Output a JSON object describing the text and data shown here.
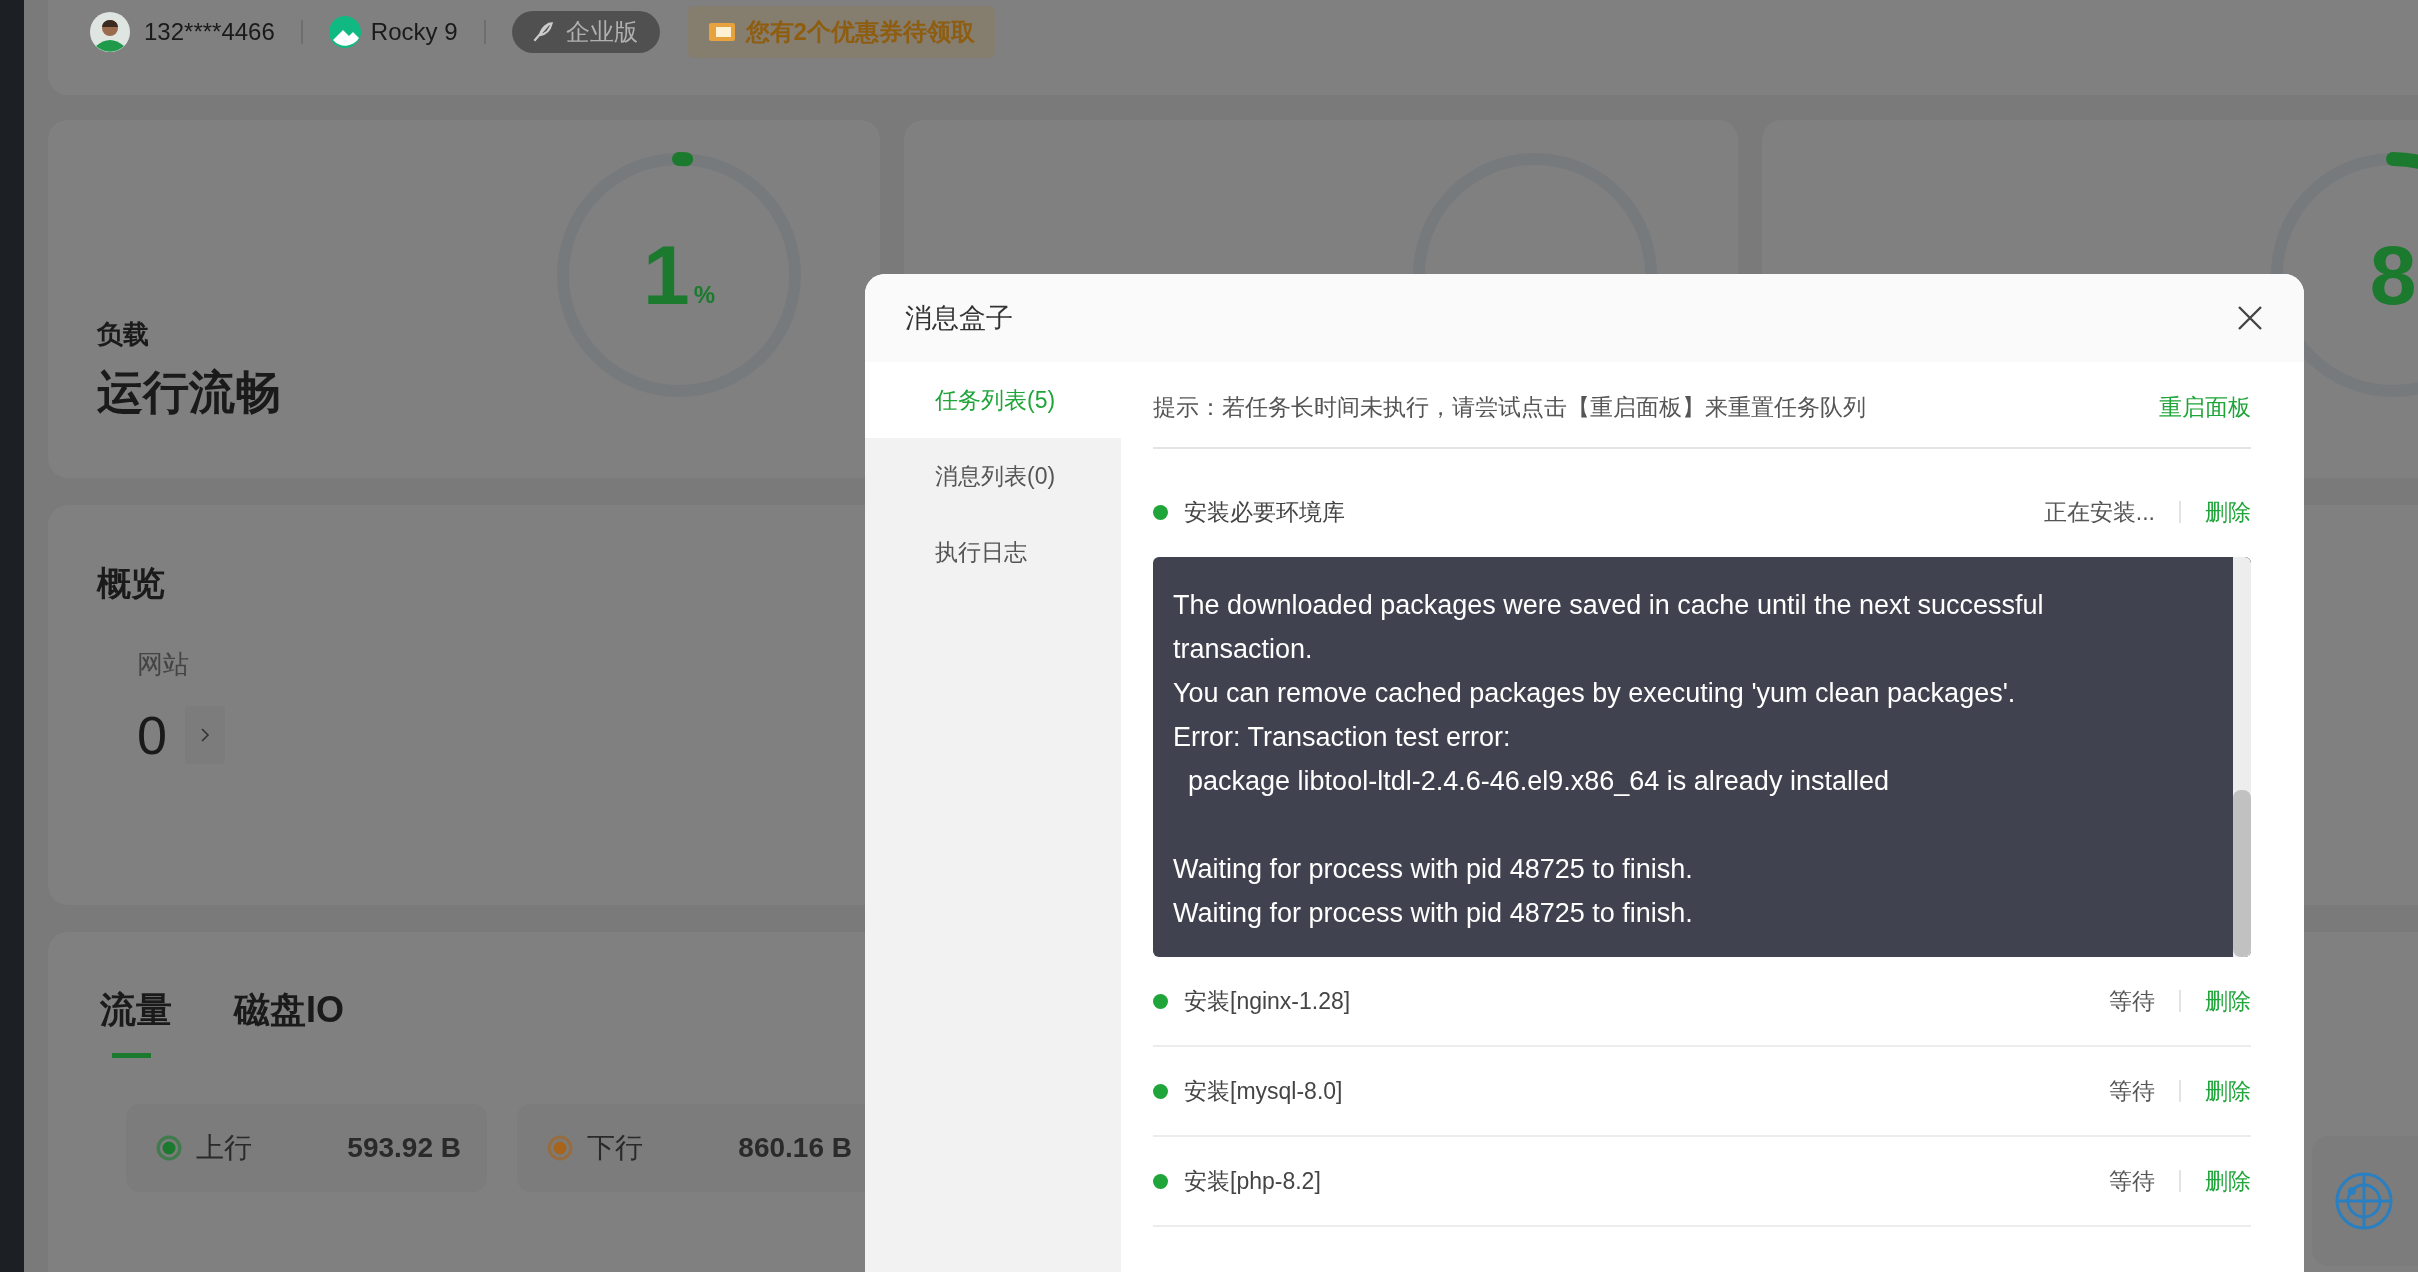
{
  "topbar": {
    "account": "132****4466",
    "os": "Rocky 9",
    "edition": "企业版",
    "coupon": "您有2个优惠券待领取"
  },
  "gauges": [
    {
      "kind": "gauge",
      "label": "负载",
      "status": "运行流畅",
      "value": "1",
      "unit": "%",
      "level": 0.01,
      "color": "#1b7a2e"
    },
    {
      "kind": "gauge"
    },
    {
      "kind": "gauge",
      "value": "8",
      "level": 0.08,
      "color": "#1b7a2e"
    }
  ],
  "overview": {
    "title": "概览",
    "stats": [
      {
        "label": "网站",
        "value": "0"
      }
    ]
  },
  "traffic": {
    "tabs": [
      {
        "label": "流量",
        "selected": true
      },
      {
        "label": "磁盘IO",
        "selected": false
      }
    ],
    "stats": [
      {
        "label": "上行",
        "value": "593.92 B",
        "color": "#1b7a2e"
      },
      {
        "label": "下行",
        "value": "860.16 B",
        "color": "#a8641a"
      }
    ]
  },
  "message_box": {
    "title": "消息盒子",
    "menu": [
      {
        "label": "任务列表(5)",
        "selected": true
      },
      {
        "label": "消息列表(0)",
        "selected": false
      },
      {
        "label": "执行日志",
        "selected": false
      }
    ],
    "hint": "提示：若任务长时间未执行，请尝试点击【重启面板】来重置任务队列",
    "restart": "重启面板",
    "tasks": [
      {
        "name": "安装必要环境库",
        "status": "正在安装...",
        "action": "删除",
        "expanded": true,
        "color": "#20a53a",
        "log": "The downloaded packages were saved in cache until the next successful transaction.\nYou can remove cached packages by executing 'yum clean packages'.\nError: Transaction test error:\n  package libtool-ltdl-2.4.6-46.el9.x86_64 is already installed\n\nWaiting for process with pid 48725 to finish.\nWaiting for process with pid 48725 to finish."
      },
      {
        "name": "安装[nginx-1.28]",
        "status": "等待",
        "action": "删除",
        "expanded": false,
        "color": "#20a53a"
      },
      {
        "name": "安装[mysql-8.0]",
        "status": "等待",
        "action": "删除",
        "expanded": false,
        "color": "#20a53a"
      },
      {
        "name": "安装[php-8.2]",
        "status": "等待",
        "action": "删除",
        "expanded": false,
        "color": "#20a53a"
      }
    ]
  }
}
